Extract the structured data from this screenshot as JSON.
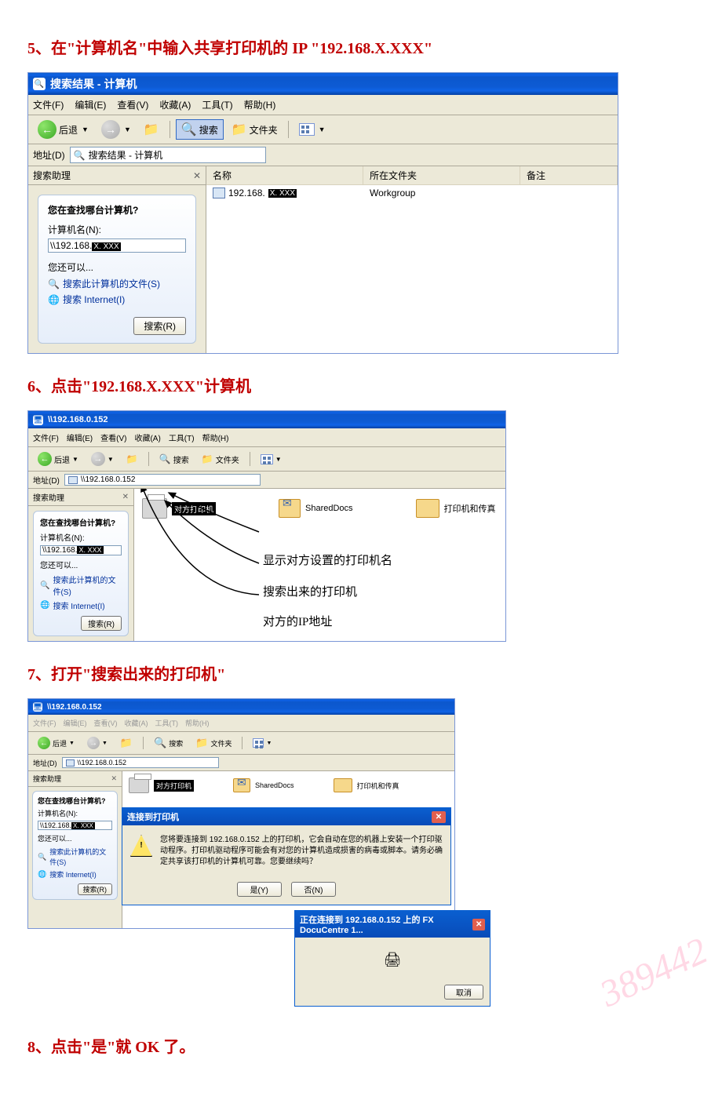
{
  "steps": {
    "s5": "5、在\"计算机名\"中输入共享打印机的 IP \"192.168.X.XXX\"",
    "s6": "6、点击\"192.168.X.XXX\"计算机",
    "s7": "7、打开\"搜索出来的打印机\"",
    "s8": "8、点击\"是\"就 OK 了。"
  },
  "win1": {
    "title": "搜索结果 - 计算机",
    "menu": {
      "file": "文件(F)",
      "edit": "编辑(E)",
      "view": "查看(V)",
      "fav": "收藏(A)",
      "tools": "工具(T)",
      "help": "帮助(H)"
    },
    "toolbar": {
      "back": "后退",
      "search": "搜索",
      "folders": "文件夹"
    },
    "address_label": "地址(D)",
    "address_value": "搜索结果 - 计算机",
    "sidebar_title": "搜索助理",
    "panel": {
      "question": "您在查找哪台计算机?",
      "field_label": "计算机名(N):",
      "field_value": "\\\\192.168.",
      "redacted": "X. XXX",
      "also": "您还可以...",
      "link1": "搜索此计算机的文件(S)",
      "link2": "搜索 Internet(I)",
      "search_btn": "搜索(R)"
    },
    "cols": {
      "name": "名称",
      "folder": "所在文件夹",
      "note": "备注"
    },
    "row": {
      "name": "192.168.",
      "redacted": "X. XXX",
      "folder": "Workgroup"
    }
  },
  "win2": {
    "title": "\\\\192.168.0.152",
    "address_value": "\\\\192.168.0.152",
    "items": {
      "printer_badge": "对方打印机",
      "shared": "SharedDocs",
      "pfax": "打印机和传真"
    },
    "annotations": {
      "a1": "显示对方设置的打印机名",
      "a2": "搜索出来的打印机",
      "a3": "对方的IP地址"
    }
  },
  "win3": {
    "title": "\\\\192.168.0.152",
    "dialog": {
      "title": "连接到打印机",
      "body": "您将要连接到 192.168.0.152 上的打印机，它会自动在您的机器上安装一个打印驱动程序。打印机驱动程序可能会有对您的计算机造成损害的病毒或脚本。请务必确定共享该打印机的计算机可靠。您要继续吗？",
      "yes": "是(Y)",
      "no": "否(N)"
    },
    "connect": {
      "title": "正在连接到 192.168.0.152 上的 FX DocuCentre 1...",
      "cancel": "取消"
    }
  }
}
